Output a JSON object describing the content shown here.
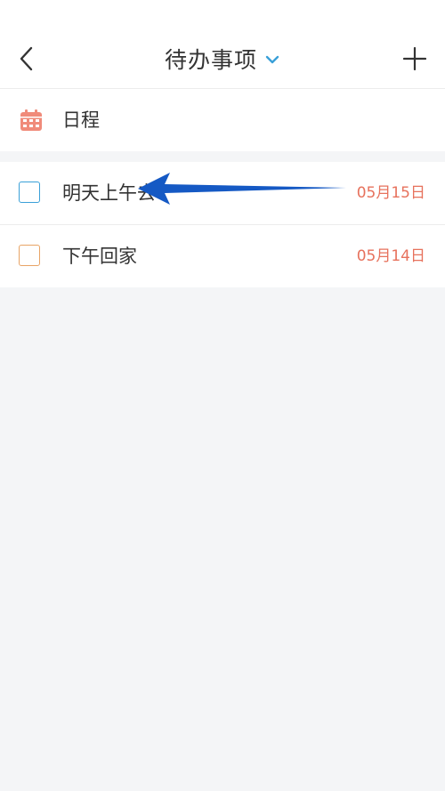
{
  "header": {
    "title": "待办事项",
    "back_icon": "chevron-left-icon",
    "dropdown_icon": "chevron-down-icon",
    "add_icon": "plus-icon"
  },
  "schedule": {
    "label": "日程",
    "icon": "calendar-icon"
  },
  "todos": [
    {
      "text": "明天上午去",
      "date": "05月15日",
      "checkbox_color": "#3aa0d8",
      "checked": false
    },
    {
      "text": "下午回家",
      "date": "05月14日",
      "checkbox_color": "#e8a466",
      "checked": false
    }
  ],
  "colors": {
    "accent": "#3aa0d8",
    "date": "#e7725d",
    "calendar": "#f08b7a",
    "annotation_arrow": "#1559c4",
    "background": "#f4f5f7"
  }
}
